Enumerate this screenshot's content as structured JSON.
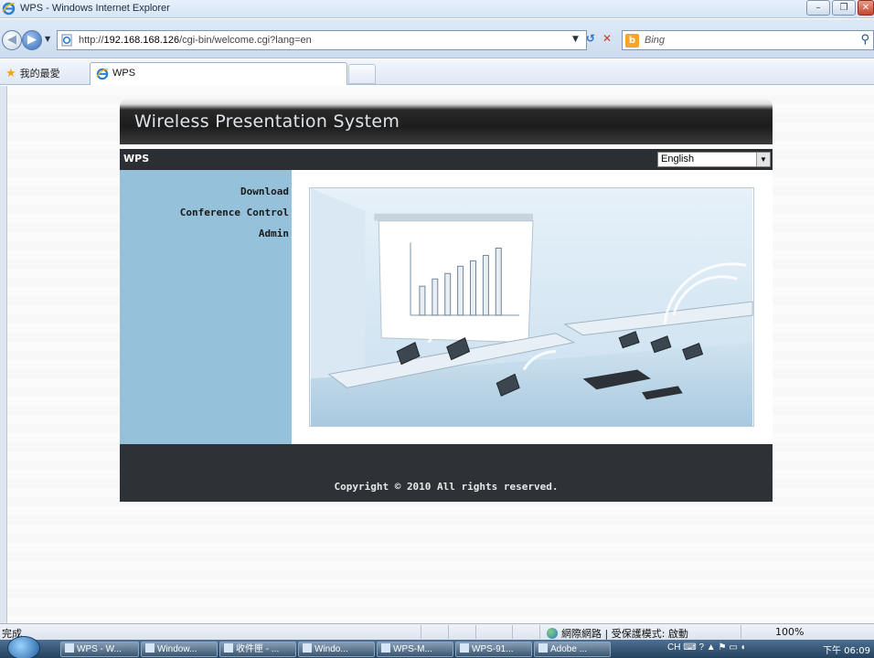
{
  "window": {
    "title": "WPS - Windows Internet Explorer"
  },
  "address": {
    "url_prefix": "http://",
    "url_host": "192.168.168.126",
    "url_path": "/cgi-bin/welcome.cgi?lang=en",
    "search_placeholder": "Bing"
  },
  "favorites": {
    "label": "我的最愛"
  },
  "tab": {
    "label": "WPS"
  },
  "page": {
    "banner_title": "Wireless Presentation System",
    "brand": "WPS",
    "language": "English",
    "menu": [
      {
        "label": "Download"
      },
      {
        "label": "Conference Control"
      },
      {
        "label": "Admin"
      }
    ],
    "footer": "Copyright © 2010 All rights reserved."
  },
  "status": {
    "text": "完成",
    "zone": "網際網路 | 受保護模式: 啟動",
    "zoom": "100%"
  },
  "taskbar": {
    "items": [
      {
        "label": "WPS - W..."
      },
      {
        "label": "Window..."
      },
      {
        "label": "收件匣 - ..."
      },
      {
        "label": "Windo..."
      },
      {
        "label": "WPS-M..."
      },
      {
        "label": "WPS-91..."
      },
      {
        "label": "Adobe ..."
      }
    ],
    "ime": "CH",
    "clock": "下午 06:09"
  },
  "colors": {
    "sidebar": "#95c1da",
    "dark_bar": "#2b2f33",
    "banner_text": "#dfe4e8"
  }
}
